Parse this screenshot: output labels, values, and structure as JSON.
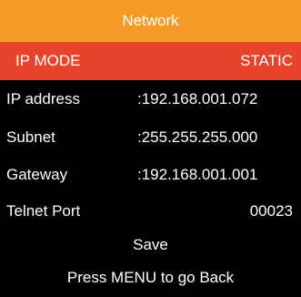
{
  "title": "Network",
  "rows": [
    {
      "label": "IP MODE",
      "value": "STATIC"
    },
    {
      "label": "IP address",
      "value": ":192.168.001.072"
    },
    {
      "label": "Subnet",
      "value": ":255.255.255.000"
    },
    {
      "label": "Gateway",
      "value": ":192.168.001.001"
    },
    {
      "label": "Telnet Port",
      "value": "00023"
    }
  ],
  "save_label": "Save",
  "footer": "Press MENU to go Back",
  "colors": {
    "title_bg": "#f39a27",
    "selected_bg": "#e8442b",
    "background": "#000000",
    "text": "#ffffff"
  }
}
